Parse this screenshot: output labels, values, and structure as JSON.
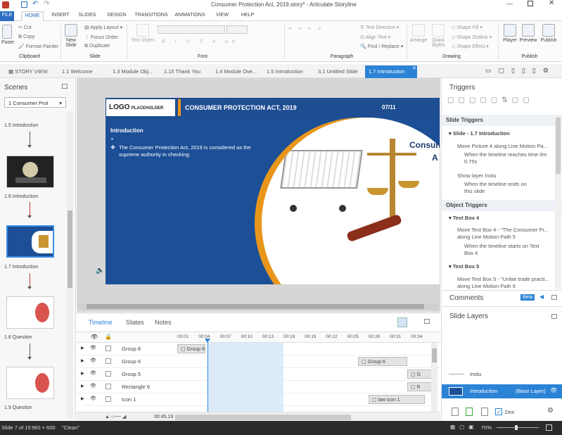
{
  "window": {
    "title": "Consumer Protection Act, 2019.story* - Articulate Storyline"
  },
  "ribbon_tabs": [
    "FILE",
    "HOME",
    "INSERT",
    "SLIDES",
    "DESIGN",
    "TRANSITIONS",
    "ANIMATIONS",
    "VIEW",
    "HELP"
  ],
  "ribbon": {
    "paste": "Paste",
    "cut": "Cut",
    "copy": "Copy",
    "format_painter": "Format Painter",
    "clipboard_label": "Clipboard",
    "new_slide": "New Slide",
    "apply_layout": "Apply Layout",
    "focus_order": "Focus Order",
    "duplicate": "Duplicate",
    "slide_label": "Slide",
    "text_styles": "Text Styles",
    "font_label": "Font",
    "text_direction": "Text Direction",
    "align_text": "Align Text",
    "find_replace": "Find / Replace",
    "paragraph_label": "Paragraph",
    "arrange": "Arrange",
    "quick_styles": "Quick Styles",
    "shape_fill": "Shape Fill",
    "shape_outline": "Shape Outline",
    "shape_effect": "Shape Effect",
    "drawing_label": "Drawing",
    "player": "Player",
    "preview": "Preview",
    "publish": "Publish",
    "publish_label": "Publish"
  },
  "slide_tabs": [
    "STORY VIEW",
    "1.1 Welcome",
    "1.3 Module Obj...",
    "1.15 Thank You",
    "1.4 Module Ove...",
    "1.5 Introduction",
    "3.1 Untitled Slide",
    "1.7 Introduction"
  ],
  "scenes": {
    "title": "Scenes",
    "dropdown": "1 Consumer Prot",
    "labels": [
      "1.5 Introduction",
      "1.6 Introduction",
      "1.7 Introduction",
      "1.8 Question",
      "1.9 Question"
    ]
  },
  "slide": {
    "logo": "LOGO",
    "logo_sub": "PLACEHOLDER",
    "header_title": "CONSUMER PROTECTION ACT, 2019",
    "page_num": "07/11",
    "section": "Introduction",
    "bullet": "The Consumer Protection Act, 2019 is considered as the supreme authority in checking:",
    "side_text_1": "Consum",
    "side_text_2": "A"
  },
  "timeline": {
    "tabs": [
      "Timeline",
      "States",
      "Notes"
    ],
    "ticks": [
      "00:01",
      "00:04",
      "00:07",
      "00:10",
      "00:13",
      "00:16",
      "00:19",
      "00:22",
      "00:25",
      "00:28",
      "00:31",
      "00:34"
    ],
    "rows": [
      {
        "name": "Group 8",
        "bar": "Group 8"
      },
      {
        "name": "Group 6",
        "bar": "Group 6"
      },
      {
        "name": "Group 5",
        "bar": "G"
      },
      {
        "name": "Rectangle 6",
        "bar": "R"
      },
      {
        "name": "Icon 1",
        "bar": "law icon 1"
      }
    ],
    "end_time": "00:45.19"
  },
  "triggers": {
    "title": "Triggers",
    "slide_triggers": "Slide Triggers",
    "slide_name": "Slide - 1.7 Introduction",
    "t1_action": "Move Picture 4 along Line Motion Pa...",
    "t1_when": "When the timeline reaches time 0m 0.75s",
    "t2_action": "Show layer Instu",
    "t2_when": "When the timeline ends on this slide",
    "object_triggers": "Object Triggers",
    "obj1": "Text Box 4",
    "obj1_action": "Move Text Box 4 - \"The Consumer Pr... along Line Motion Path 5",
    "obj1_when": "When the timeline starts on Text Box 4",
    "obj2": "Text Box 5",
    "obj2_action": "Move Text Box 5 - \"Unfair trade practi... along Line Motion Path 6"
  },
  "comments": {
    "title": "Comments",
    "badge": "Beta"
  },
  "layers": {
    "title": "Slide Layers",
    "layer1": "Instu",
    "base": "Introduction",
    "base_tag": "(Base Layer)",
    "dim": "Dim"
  },
  "status": {
    "slide": "Slide 7 of 15",
    "size": "960 × 600",
    "theme": "\"Clean\"",
    "zoom": "70%"
  },
  "colors": {
    "accent": "#2a6ebb",
    "slide_blue": "#1c4f96",
    "orange": "#e8961b",
    "active_tab": "#2b83d6"
  }
}
